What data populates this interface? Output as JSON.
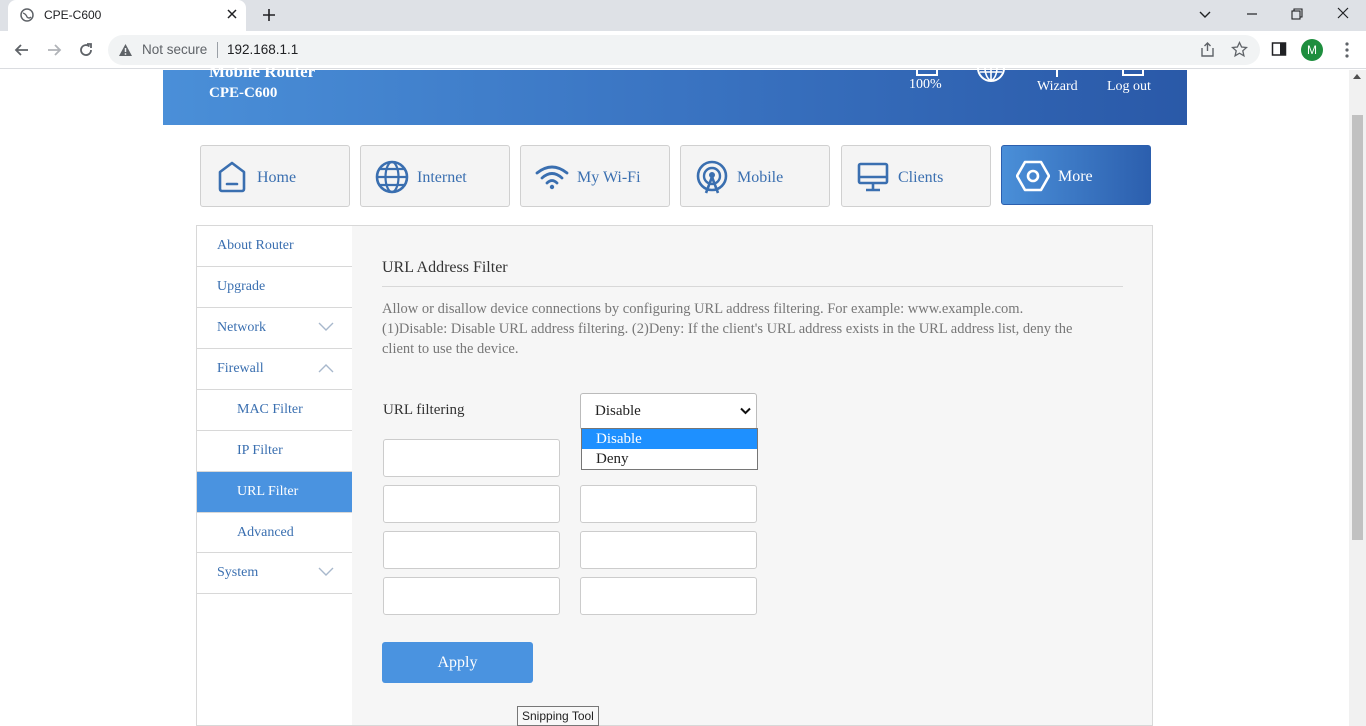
{
  "browser": {
    "tab_title": "CPE-C600",
    "security_label": "Not secure",
    "url": "192.168.1.1",
    "profile_initial": "M"
  },
  "header": {
    "brand_line1": "Mobile Router",
    "brand_line2": "CPE-C600",
    "battery_label": "100%",
    "wizard_label": "Wizard",
    "logout_label": "Log out"
  },
  "nav": {
    "tiles": [
      {
        "label": "Home",
        "icon": "home-icon"
      },
      {
        "label": "Internet",
        "icon": "globe-icon"
      },
      {
        "label": "My Wi-Fi",
        "icon": "wifi-icon"
      },
      {
        "label": "Mobile",
        "icon": "antenna-icon"
      },
      {
        "label": "Clients",
        "icon": "monitor-icon"
      },
      {
        "label": "More",
        "icon": "hexagon-icon"
      }
    ],
    "active": "More"
  },
  "sidemenu": {
    "items": [
      {
        "label": "About Router"
      },
      {
        "label": "Upgrade"
      },
      {
        "label": "Network"
      },
      {
        "label": "Firewall"
      },
      {
        "label": "MAC Filter"
      },
      {
        "label": "IP Filter"
      },
      {
        "label": "URL Filter"
      },
      {
        "label": "Advanced"
      },
      {
        "label": "System"
      }
    ],
    "selected": "URL Filter"
  },
  "content": {
    "title": "URL Address Filter",
    "description": "Allow or disallow device connections by configuring URL address filtering. For example: www.example.com. (1)Disable: Disable URL address filtering. (2)Deny: If the client's URL address exists in the URL address list, deny the client to use the device.",
    "filtering_label": "URL filtering",
    "filtering_value": "Disable",
    "options": [
      "Disable",
      "Deny"
    ],
    "highlighted_option": "Disable",
    "apply_label": "Apply"
  },
  "tooltip": "Snipping Tool",
  "colors": {
    "accent": "#4a93e0",
    "header_gradient_start": "#4a8fd8",
    "header_gradient_end": "#2a59a8",
    "menu_text": "#3a6fb0",
    "option_highlight": "#1e90ff"
  }
}
